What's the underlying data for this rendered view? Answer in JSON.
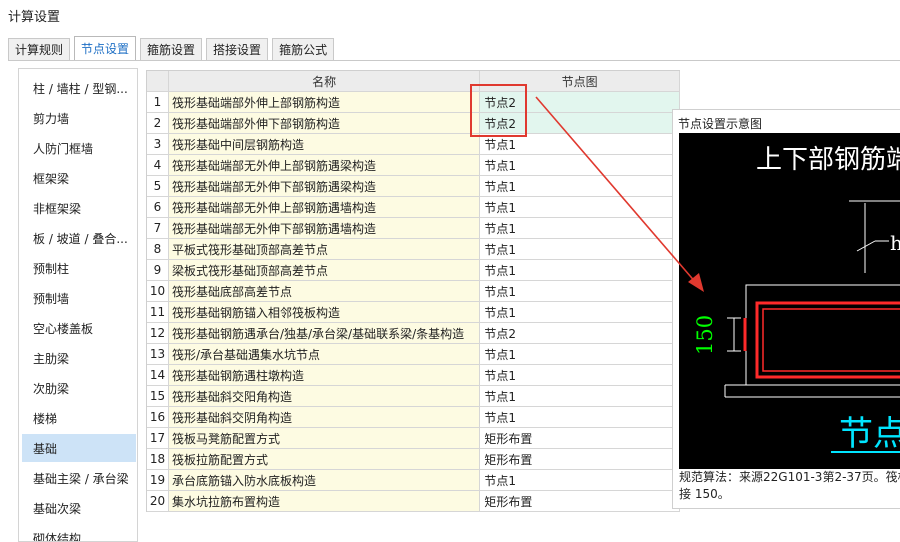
{
  "window": {
    "title": "计算设置"
  },
  "tabs": [
    {
      "label": "计算规则",
      "active": false
    },
    {
      "label": "节点设置",
      "active": true
    },
    {
      "label": "箍筋设置",
      "active": false
    },
    {
      "label": "搭接设置",
      "active": false
    },
    {
      "label": "箍筋公式",
      "active": false
    }
  ],
  "sidebar": {
    "selected": "基础",
    "items": [
      "柱 / 墙柱 / 型钢...",
      "剪力墙",
      "人防门框墙",
      "框架梁",
      "非框架梁",
      "板 / 坡道 / 叠合...",
      "预制柱",
      "预制墙",
      "空心楼盖板",
      "主肋梁",
      "次肋梁",
      "楼梯",
      "基础",
      "基础主梁 / 承台梁",
      "基础次梁",
      "砌体结构"
    ]
  },
  "grid": {
    "headers": {
      "name": "名称",
      "node": "节点图"
    },
    "rows": [
      {
        "num": "1",
        "name": "筏形基础端部外伸上部钢筋构造",
        "node": "节点2"
      },
      {
        "num": "2",
        "name": "筏形基础端部外伸下部钢筋构造",
        "node": "节点2"
      },
      {
        "num": "3",
        "name": "筏形基础中间层钢筋构造",
        "node": "节点1"
      },
      {
        "num": "4",
        "name": "筏形基础端部无外伸上部钢筋遇梁构造",
        "node": "节点1"
      },
      {
        "num": "5",
        "name": "筏形基础端部无外伸下部钢筋遇梁构造",
        "node": "节点1"
      },
      {
        "num": "6",
        "name": "筏形基础端部无外伸上部钢筋遇墙构造",
        "node": "节点1"
      },
      {
        "num": "7",
        "name": "筏形基础端部无外伸下部钢筋遇墙构造",
        "node": "节点1"
      },
      {
        "num": "8",
        "name": "平板式筏形基础顶部高差节点",
        "node": "节点1"
      },
      {
        "num": "9",
        "name": "梁板式筏形基础顶部高差节点",
        "node": "节点1"
      },
      {
        "num": "10",
        "name": "筏形基础底部高差节点",
        "node": "节点1"
      },
      {
        "num": "11",
        "name": "筏形基础钢筋锚入相邻筏板构造",
        "node": "节点1"
      },
      {
        "num": "12",
        "name": "筏形基础钢筋遇承台/独基/承台梁/基础联系梁/条基构造",
        "node": "节点2"
      },
      {
        "num": "13",
        "name": "筏形/承台基础遇集水坑节点",
        "node": "节点1"
      },
      {
        "num": "14",
        "name": "筏形基础钢筋遇柱墩构造",
        "node": "节点1"
      },
      {
        "num": "15",
        "name": "筏形基础斜交阳角构造",
        "node": "节点1"
      },
      {
        "num": "16",
        "name": "筏形基础斜交阴角构造",
        "node": "节点1"
      },
      {
        "num": "17",
        "name": "筏板马凳筋配置方式",
        "node": "矩形布置"
      },
      {
        "num": "18",
        "name": "筏板拉筋配置方式",
        "node": "矩形布置"
      },
      {
        "num": "19",
        "name": "承台底筋锚入防水底板构造",
        "node": "节点1"
      },
      {
        "num": "20",
        "name": "集水坑拉筋布置构造",
        "node": "矩形布置"
      }
    ]
  },
  "diagram": {
    "title": "节点设置示意图",
    "heading": "上下部钢筋端",
    "dim_label": "150",
    "h_label": "h",
    "node_caption": "节点",
    "note_line1": "规范算法：来源22G101-3第2-37页。筏板",
    "note_line2": "接 150。"
  },
  "colors": {
    "callout": "#e0392f",
    "selected_row": "#e2f6ee",
    "name_column": "#fdfbe2",
    "sidebar_selected": "#cde3f7",
    "active_tab_text": "#1e6fc5",
    "diagram_bg": "#000000",
    "diagram_heading": "#ffffff",
    "diagram_red": "#ff2a2a",
    "diagram_green": "#00ff00",
    "diagram_cyan": "#00e5ff"
  }
}
